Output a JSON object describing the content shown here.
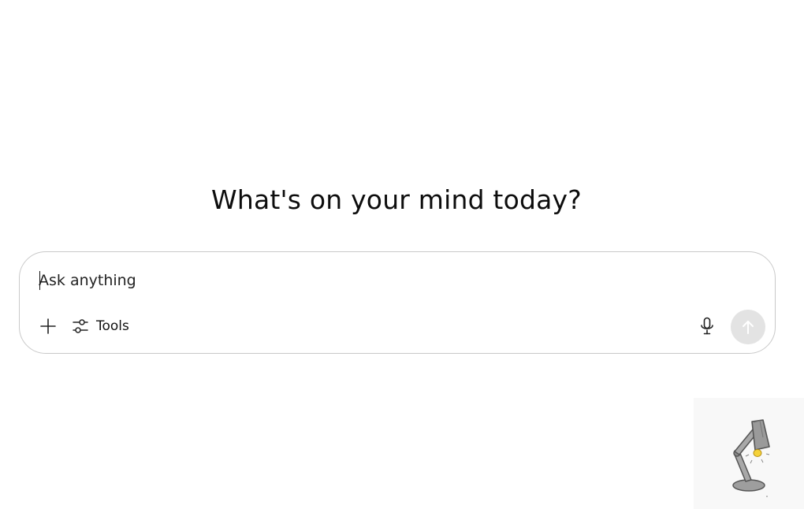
{
  "headline": "What's on your mind today?",
  "composer": {
    "placeholder": "Ask anything",
    "value": ""
  },
  "toolbar": {
    "tools_label": "Tools"
  },
  "icons": {
    "add": "plus-icon",
    "tools": "sliders-icon",
    "mic": "microphone-icon",
    "send": "arrow-up-icon",
    "mascot": "desk-lamp-icon"
  },
  "colors": {
    "send_button_bg": "#e3e3e3",
    "send_arrow": "#ffffff",
    "composer_border": "#c9c9c9",
    "lamp_body": "#9e9e9e",
    "lamp_bulb": "#f5d23a"
  }
}
